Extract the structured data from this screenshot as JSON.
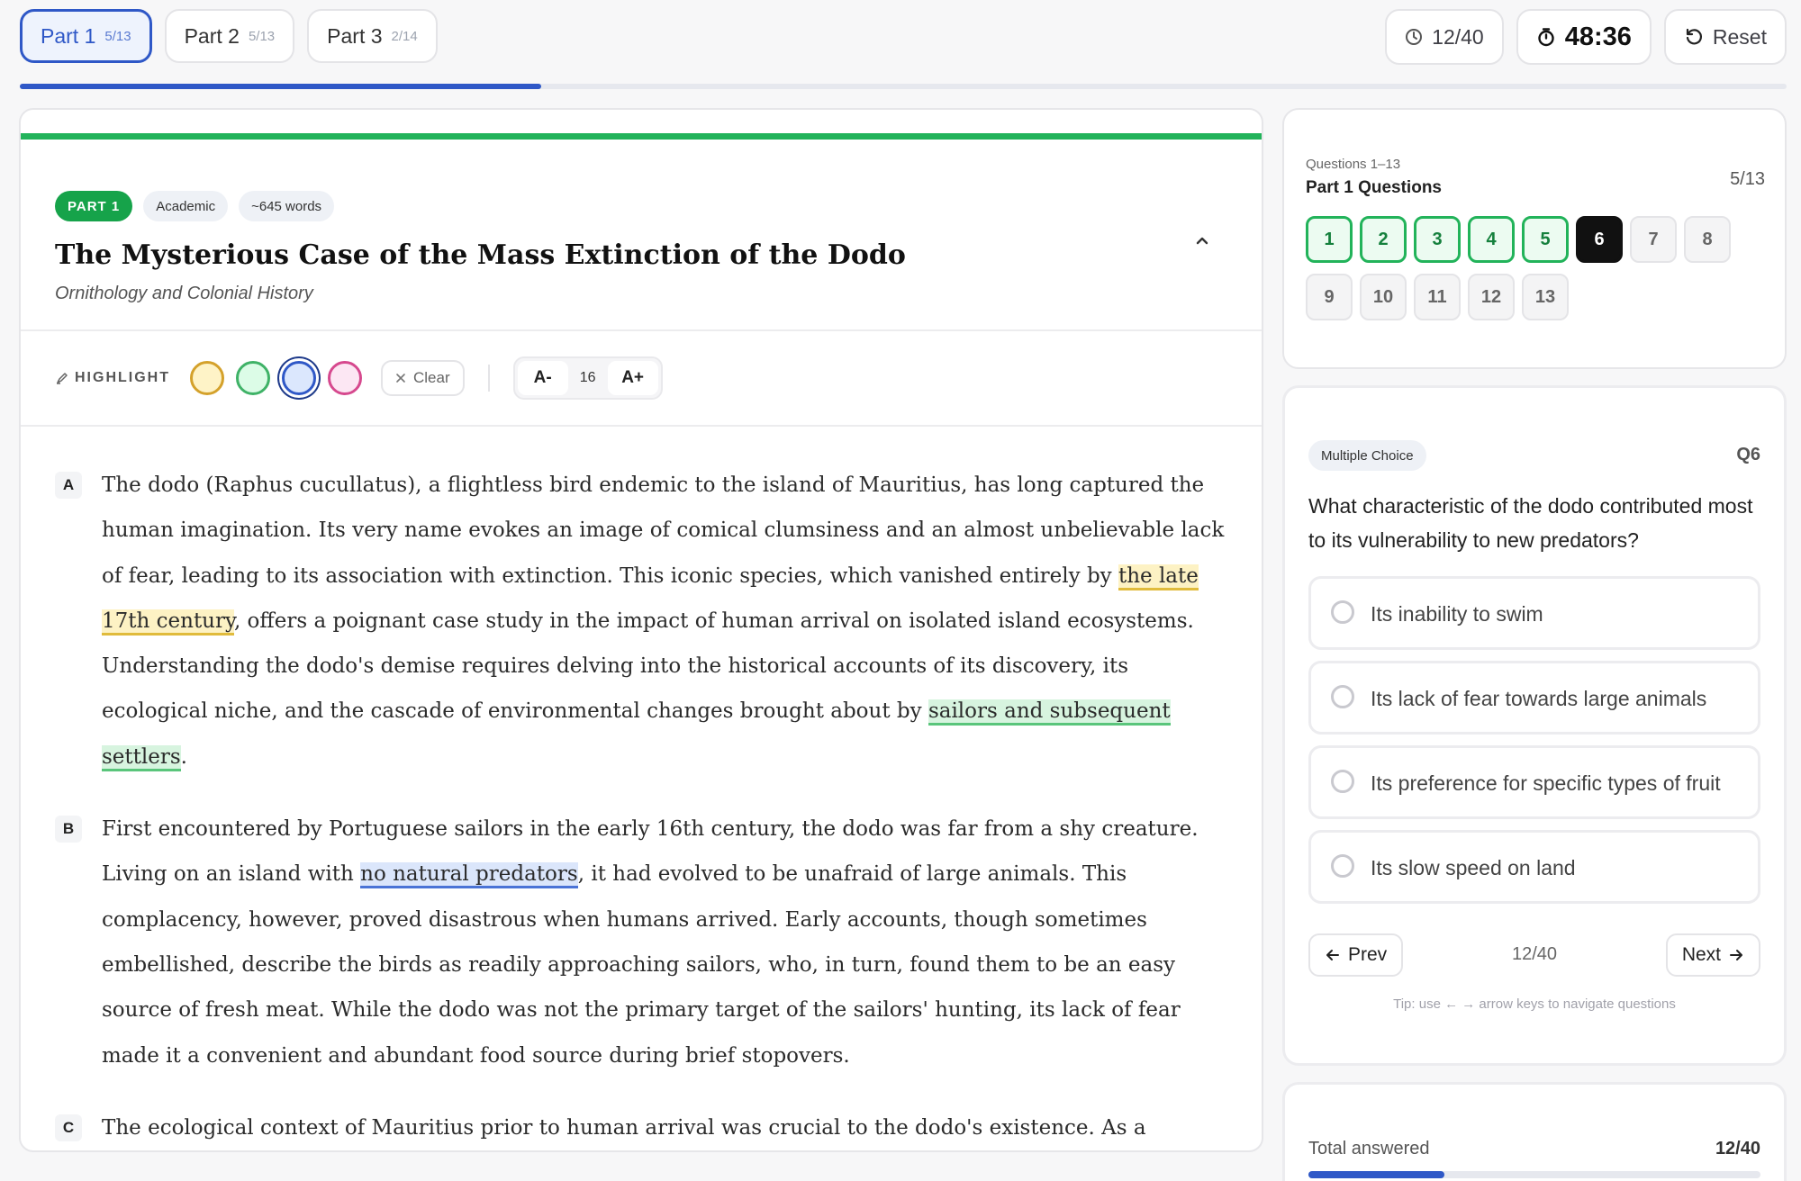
{
  "part_tabs": [
    {
      "label": "Part 1",
      "count": "5/13",
      "active": true
    },
    {
      "label": "Part 2",
      "count": "5/13",
      "active": false
    },
    {
      "label": "Part 3",
      "count": "2/14",
      "active": false
    }
  ],
  "header": {
    "answered_pill": "12/40",
    "timer": "48:36",
    "reset_label": "Reset",
    "progress_fraction": 0.295,
    "icons": [
      "clock-icon",
      "stopwatch-icon",
      "reset-icon"
    ]
  },
  "reading": {
    "tags": {
      "part": "PART 1",
      "type": "Academic",
      "words": "~645 words"
    },
    "title": "The Mysterious Case of the Mass Extinction of the Dodo",
    "subtitle": "Ornithology and Colonial History",
    "toolbar": {
      "highlight_label": "HIGHLIGHT",
      "swatches": [
        "yellow",
        "green",
        "blue",
        "pink"
      ],
      "selected_swatch": "blue",
      "clear_label": "Clear",
      "font_decrease": "A-",
      "font_size": "16",
      "font_increase": "A+"
    },
    "paragraphs": [
      {
        "letter": "A",
        "segments": [
          {
            "text": "The dodo (Raphus cucullatus), a flightless bird endemic to the island of Mauritius, has long captured the human imagination. Its very name evokes an image of comical clumsiness and an almost unbelievable lack of fear, leading to its association with extinction. This iconic species, which vanished entirely by ",
            "hl": ""
          },
          {
            "text": "the late 17th century",
            "hl": "y"
          },
          {
            "text": ", offers a poignant case study in the impact of human arrival on isolated island ecosystems. Understanding the dodo's demise requires delving into the historical accounts of its discovery, its ecological niche, and the cascade of environmental changes brought about by ",
            "hl": ""
          },
          {
            "text": "sailors and subsequent settlers",
            "hl": "g"
          },
          {
            "text": ".",
            "hl": ""
          }
        ]
      },
      {
        "letter": "B",
        "segments": [
          {
            "text": "First encountered by Portuguese sailors in the early 16th century, the dodo was far from a shy creature. Living on an island with ",
            "hl": ""
          },
          {
            "text": "no natural predators",
            "hl": "b"
          },
          {
            "text": ", it had evolved to be unafraid of large animals. This complacency, however, proved disastrous when humans arrived. Early accounts, though sometimes embellished, describe the birds as readily approaching sailors, who, in turn, found them to be an easy source of fresh meat. While the dodo was not the primary target of the sailors' hunting, its lack of fear made it a convenient and abundant food source during brief stopovers.",
            "hl": ""
          }
        ]
      },
      {
        "letter": "C",
        "segments": [
          {
            "text": "The ecological context of Mauritius prior to human arrival was crucial to the dodo's existence. As a flightless",
            "hl": ""
          }
        ]
      }
    ]
  },
  "question_nav": {
    "range_label": "Questions 1–13",
    "title": "Part 1 Questions",
    "count": "5/13",
    "buttons": [
      {
        "label": "1",
        "state": "done"
      },
      {
        "label": "2",
        "state": "done"
      },
      {
        "label": "3",
        "state": "done"
      },
      {
        "label": "4",
        "state": "done"
      },
      {
        "label": "5",
        "state": "done"
      },
      {
        "label": "6",
        "state": "current"
      },
      {
        "label": "7",
        "state": "todo"
      },
      {
        "label": "8",
        "state": "todo"
      },
      {
        "label": "9",
        "state": "todo"
      },
      {
        "label": "10",
        "state": "todo"
      },
      {
        "label": "11",
        "state": "todo"
      },
      {
        "label": "12",
        "state": "todo"
      },
      {
        "label": "13",
        "state": "todo"
      }
    ]
  },
  "question": {
    "type": "Multiple Choice",
    "number": "Q6",
    "text": "What characteristic of the dodo contributed most to its vulnerability to new predators?",
    "options": [
      "Its inability to swim",
      "Its lack of fear towards large animals",
      "Its preference for specific types of fruit",
      "Its slow speed on land"
    ],
    "prev_label": "Prev",
    "next_label": "Next",
    "counter": "12/40",
    "tip": "Tip: use ← → arrow keys to navigate questions"
  },
  "totals": {
    "label": "Total answered",
    "value": "12/40",
    "fraction": 0.3
  },
  "colors": {
    "accent_blue": "#2f58c7",
    "success_green": "#22b35a",
    "current_black": "#111111"
  }
}
